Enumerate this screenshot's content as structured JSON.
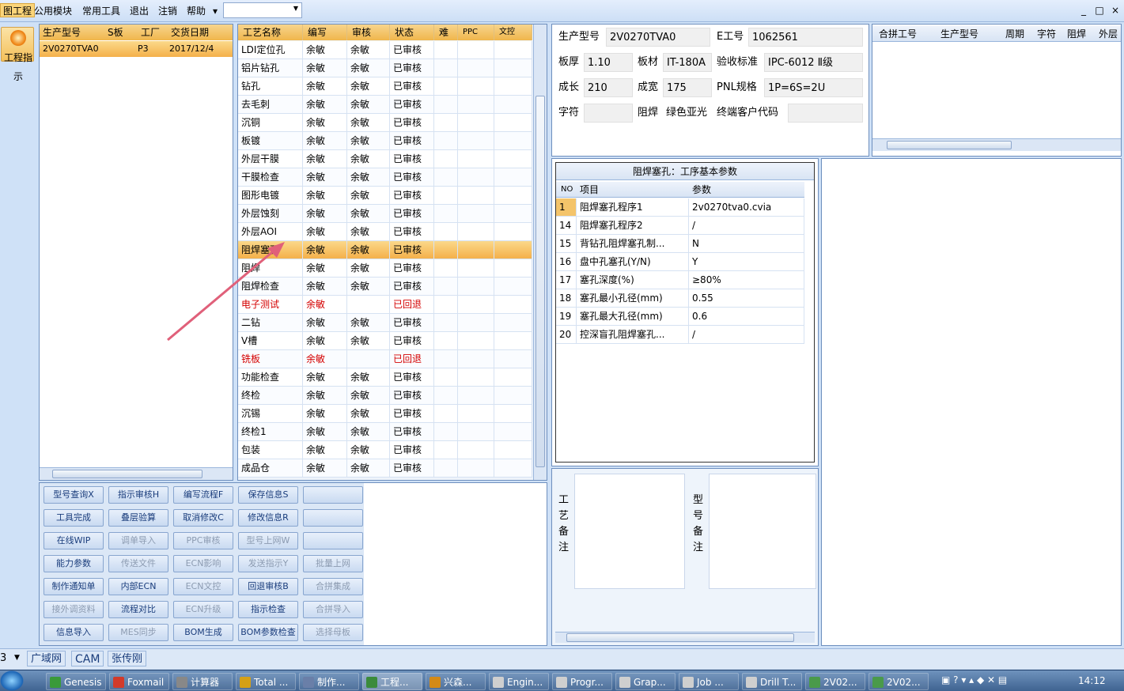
{
  "menu": {
    "items": [
      "图工程",
      "公用模块",
      "常用工具",
      "退出",
      "注销",
      "帮助"
    ],
    "combo_value": ""
  },
  "window_controls": [
    "_",
    "□",
    "×"
  ],
  "guide_button": "工程指示",
  "model_table": {
    "headers": [
      "生产型号",
      "S板",
      "工厂",
      "交货日期"
    ],
    "rows": [
      [
        "2V0270TVA0",
        "",
        "P3",
        "2017/12/4"
      ]
    ]
  },
  "process_table": {
    "headers": [
      "工艺名称",
      "编写",
      "审核",
      "状态",
      "难",
      "PPC",
      "文控"
    ],
    "rows": [
      {
        "name": "LDI定位孔",
        "writer": "余敏",
        "reviewer": "余敏",
        "status": "已审核",
        "red": false
      },
      {
        "name": "铝片钻孔",
        "writer": "余敏",
        "reviewer": "余敏",
        "status": "已审核",
        "red": false
      },
      {
        "name": "钻孔",
        "writer": "余敏",
        "reviewer": "余敏",
        "status": "已审核",
        "red": false
      },
      {
        "name": "去毛刺",
        "writer": "余敏",
        "reviewer": "余敏",
        "status": "已审核",
        "red": false
      },
      {
        "name": "沉铜",
        "writer": "余敏",
        "reviewer": "余敏",
        "status": "已审核",
        "red": false
      },
      {
        "name": "板镀",
        "writer": "余敏",
        "reviewer": "余敏",
        "status": "已审核",
        "red": false
      },
      {
        "name": "外层干膜",
        "writer": "余敏",
        "reviewer": "余敏",
        "status": "已审核",
        "red": false
      },
      {
        "name": "干膜检查",
        "writer": "余敏",
        "reviewer": "余敏",
        "status": "已审核",
        "red": false
      },
      {
        "name": "图形电镀",
        "writer": "余敏",
        "reviewer": "余敏",
        "status": "已审核",
        "red": false
      },
      {
        "name": "外层蚀刻",
        "writer": "余敏",
        "reviewer": "余敏",
        "status": "已审核",
        "red": false
      },
      {
        "name": "外层AOI",
        "writer": "余敏",
        "reviewer": "余敏",
        "status": "已审核",
        "red": false
      },
      {
        "name": "阻焊塞孔",
        "writer": "余敏",
        "reviewer": "余敏",
        "status": "已审核",
        "red": false,
        "selected": true
      },
      {
        "name": "阻焊",
        "writer": "余敏",
        "reviewer": "余敏",
        "status": "已审核",
        "red": false
      },
      {
        "name": "阻焊检查",
        "writer": "余敏",
        "reviewer": "余敏",
        "status": "已审核",
        "red": false
      },
      {
        "name": "电子测试",
        "writer": "余敏",
        "reviewer": "",
        "status": "已回退",
        "red": true
      },
      {
        "name": "二钻",
        "writer": "余敏",
        "reviewer": "余敏",
        "status": "已审核",
        "red": false
      },
      {
        "name": "V槽",
        "writer": "余敏",
        "reviewer": "余敏",
        "status": "已审核",
        "red": false
      },
      {
        "name": "铣板",
        "writer": "余敏",
        "reviewer": "",
        "status": "已回退",
        "red": true
      },
      {
        "name": "功能检查",
        "writer": "余敏",
        "reviewer": "余敏",
        "status": "已审核",
        "red": false
      },
      {
        "name": "终检",
        "writer": "余敏",
        "reviewer": "余敏",
        "status": "已审核",
        "red": false
      },
      {
        "name": "沉锡",
        "writer": "余敏",
        "reviewer": "余敏",
        "status": "已审核",
        "red": false
      },
      {
        "name": "终检1",
        "writer": "余敏",
        "reviewer": "余敏",
        "status": "已审核",
        "red": false
      },
      {
        "name": "包装",
        "writer": "余敏",
        "reviewer": "余敏",
        "status": "已审核",
        "red": false
      },
      {
        "name": "成品仓",
        "writer": "余敏",
        "reviewer": "余敏",
        "status": "已审核",
        "red": false
      }
    ]
  },
  "buttons": [
    [
      {
        "t": "型号查询X",
        "d": false
      },
      {
        "t": "指示审核H",
        "d": false
      },
      {
        "t": "编写流程F",
        "d": false
      },
      {
        "t": "保存信息S",
        "d": false
      },
      {
        "t": "",
        "d": false
      }
    ],
    [
      {
        "t": "工具完成",
        "d": false
      },
      {
        "t": "叠层验算",
        "d": false
      },
      {
        "t": "取消修改C",
        "d": false
      },
      {
        "t": "修改信息R",
        "d": false
      },
      {
        "t": "",
        "d": false
      }
    ],
    [
      {
        "t": "在线WIP",
        "d": false
      },
      {
        "t": "调单导入",
        "d": true
      },
      {
        "t": "PPC审核",
        "d": true
      },
      {
        "t": "型号上网W",
        "d": true
      },
      {
        "t": "",
        "d": false
      }
    ],
    [
      {
        "t": "能力参数",
        "d": false
      },
      {
        "t": "传送文件",
        "d": true
      },
      {
        "t": "ECN影响",
        "d": true
      },
      {
        "t": "发送指示Y",
        "d": true
      },
      {
        "t": "批量上网",
        "d": true
      }
    ],
    [
      {
        "t": "制作通知单",
        "d": false
      },
      {
        "t": "内部ECN",
        "d": false
      },
      {
        "t": "ECN文控",
        "d": true
      },
      {
        "t": "回退审核B",
        "d": false
      },
      {
        "t": "合拼集成",
        "d": true
      }
    ],
    [
      {
        "t": "接外调资料",
        "d": true
      },
      {
        "t": "流程对比",
        "d": false
      },
      {
        "t": "ECN升级",
        "d": true
      },
      {
        "t": "指示检查",
        "d": false
      },
      {
        "t": "合拼导入",
        "d": true
      }
    ],
    [
      {
        "t": "信息导入",
        "d": false
      },
      {
        "t": "MES同步",
        "d": true
      },
      {
        "t": "BOM生成",
        "d": false
      },
      {
        "t": "BOM参数检查",
        "d": false
      },
      {
        "t": "选择母板",
        "d": true
      }
    ]
  ],
  "info": {
    "model_label": "生产型号",
    "model_value": "2V0270TVA0",
    "e_label": "E工号",
    "e_value": "1062561",
    "thickness_label": "板厚",
    "thickness_value": "1.10",
    "material_label": "板材",
    "material_value": "IT-180A",
    "standard_label": "验收标准",
    "standard_value": "IPC-6012 Ⅱ级",
    "length_label": "成长",
    "length_value": "210",
    "width_label": "成宽",
    "width_value": "175",
    "pnl_label": "PNL规格",
    "pnl_value": "1P=6S=2U",
    "char_label": "字符",
    "char_value": "",
    "mask_label": "阻焊",
    "mask_value": "绿色亚光",
    "customer_label": "终端客户代码",
    "customer_value": ""
  },
  "merge_table": {
    "headers": [
      "合拼工号",
      "生产型号",
      "周期",
      "字符",
      "阻焊",
      "外层"
    ]
  },
  "params": {
    "title": "阻焊塞孔：工序基本参数",
    "headers": [
      "NO",
      "项目",
      "参数"
    ],
    "rows": [
      {
        "no": "1",
        "item": "阻焊塞孔程序1",
        "value": "2v0270tva0.cvia",
        "hl": true
      },
      {
        "no": "14",
        "item": "阻焊塞孔程序2",
        "value": "/"
      },
      {
        "no": "15",
        "item": "背钻孔阻焊塞孔制...",
        "value": "N"
      },
      {
        "no": "16",
        "item": "盘中孔塞孔(Y/N)",
        "value": "Y"
      },
      {
        "no": "17",
        "item": "塞孔深度(%)",
        "value": "≥80%"
      },
      {
        "no": "18",
        "item": "塞孔最小孔径(mm)",
        "value": "0.55"
      },
      {
        "no": "19",
        "item": "塞孔最大孔径(mm)",
        "value": "0.6"
      },
      {
        "no": "20",
        "item": "控深盲孔阻焊塞孔...",
        "value": "/"
      }
    ]
  },
  "notes": {
    "process_label": "工艺备注",
    "model_label": "型号备注"
  },
  "statusbar": [
    "3",
    "广域网",
    "CAM",
    "张传刚"
  ],
  "taskbar": {
    "items": [
      "Genesis",
      "Foxmail",
      "计算器",
      "Total ...",
      "制作...",
      "工程...",
      "兴森...",
      "Engin...",
      "Progr...",
      "Grap...",
      "Job ...",
      "Drill T...",
      "2V02...",
      "2V02..."
    ],
    "clock": "14:12"
  },
  "colors": {
    "accent": "#f4b04a",
    "red": "#d40000",
    "arrow": "#e0607a"
  }
}
